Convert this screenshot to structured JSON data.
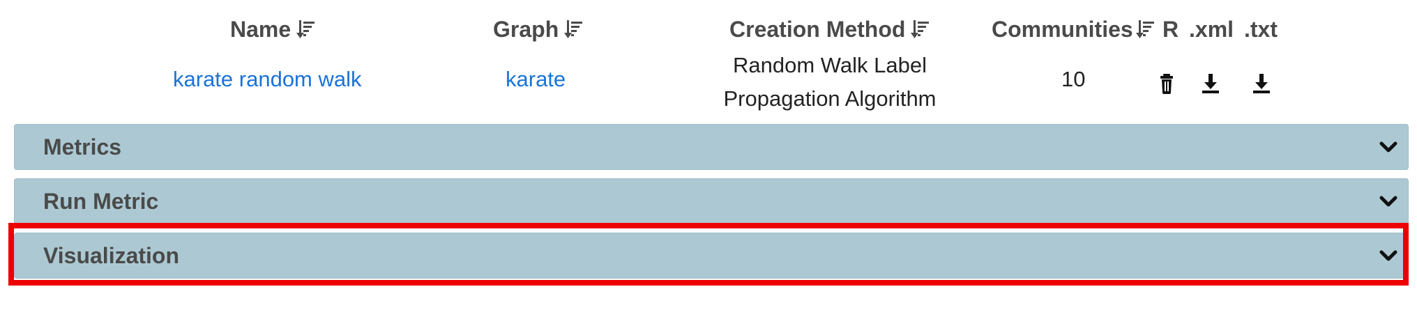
{
  "table": {
    "headers": {
      "name": "Name",
      "graph": "Graph",
      "creation_method": "Creation Method",
      "communities": "Communities",
      "r": "R",
      "xml": ".xml",
      "txt": ".txt"
    },
    "row": {
      "name": "karate random walk",
      "graph": "karate",
      "creation_method_line1": "Random Walk Label",
      "creation_method_line2": "Propagation Algorithm",
      "communities": "10"
    },
    "icons": {
      "sort": "sort-amount-down-icon",
      "delete": "trash-icon",
      "download_xml": "download-icon",
      "download_txt": "download-icon"
    }
  },
  "accordion": {
    "panels": [
      {
        "label": "Metrics",
        "icon": "chevron-down-icon"
      },
      {
        "label": "Run Metric",
        "icon": "chevron-down-icon"
      },
      {
        "label": "Visualization",
        "icon": "chevron-down-icon",
        "highlighted": true
      }
    ],
    "panel_color": "#acc9d3",
    "highlight_color": "#ee0000"
  },
  "colors": {
    "link": "#1a73d9",
    "header_text": "#4a4a4a"
  }
}
